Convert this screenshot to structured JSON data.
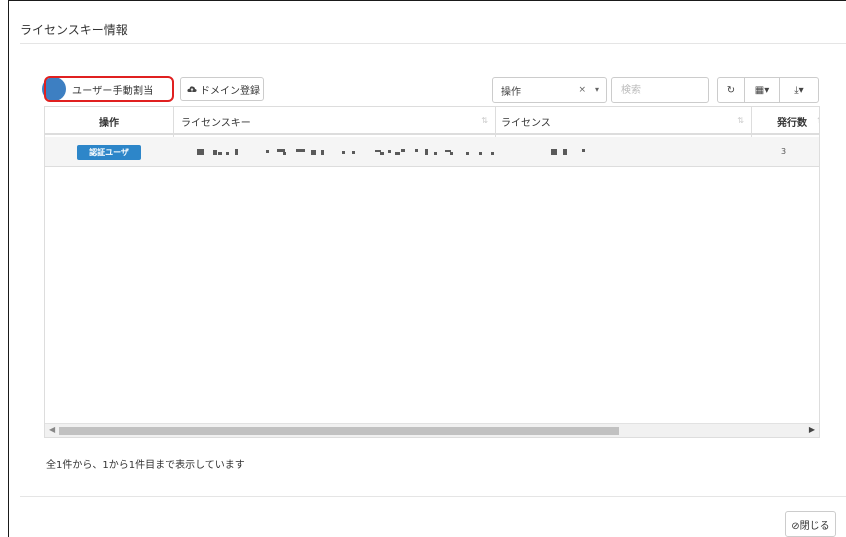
{
  "modal": {
    "title": "ライセンスキー情報",
    "close_label": "⊘閉じる"
  },
  "toolbar": {
    "manual_assign_label": "ユーザー手動割当",
    "domain_register_label": "ドメイン登録",
    "operation_select_value": "操作",
    "clear_symbol": "×",
    "arrow_symbol": "▾",
    "search_placeholder": "検索",
    "refresh_icon_glyph": "↻",
    "columns_label": "▦▾",
    "export_label": "⤓▾"
  },
  "table": {
    "columns": [
      "操作",
      "ライセンスキー",
      "ライセンス",
      "発行数"
    ],
    "sort_glyph": "⇅",
    "rows": [
      {
        "action_badge": "認証ユーザ",
        "license_key": "",
        "license": "",
        "issued_count": "3"
      }
    ]
  },
  "pagination": {
    "info": "全1件から、1から1件目まで表示しています"
  },
  "colors": {
    "primary": "#3d7fc2",
    "badge": "#2d86c9",
    "highlight_ring": "#e02020"
  }
}
